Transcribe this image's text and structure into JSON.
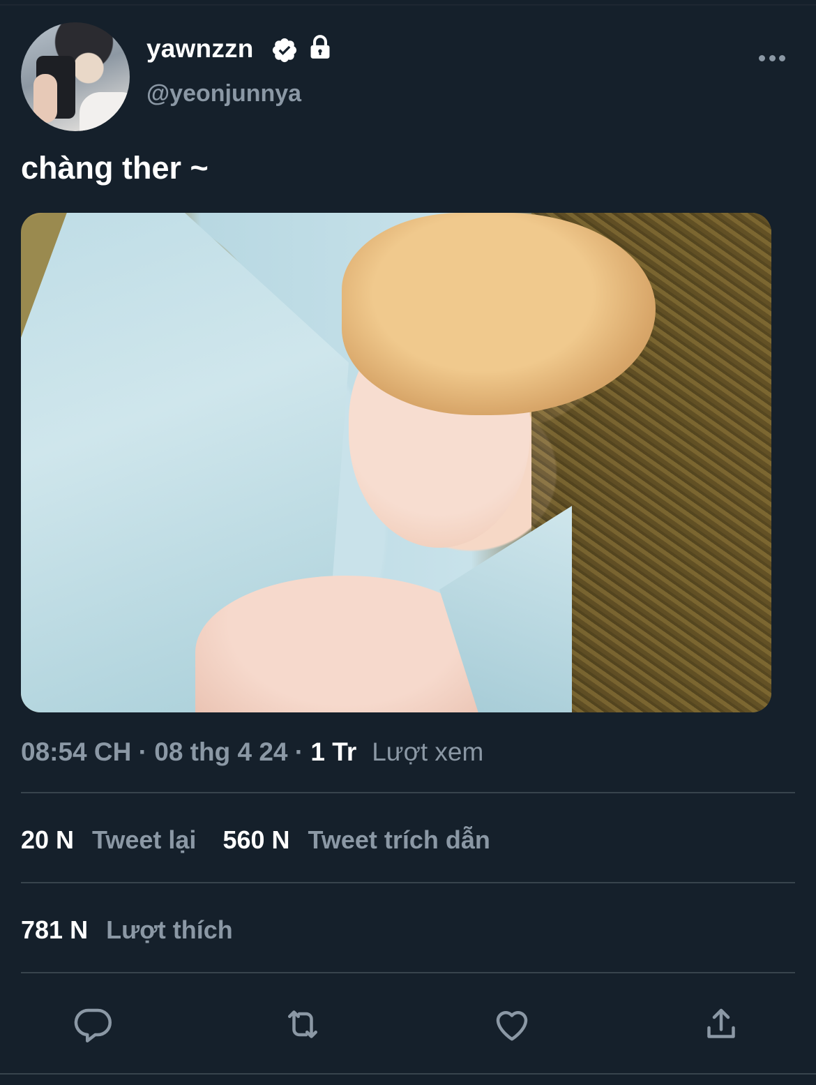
{
  "author": {
    "display_name": "yawnzzn",
    "handle": "@yeonjunnya",
    "verified_icon": "verified-badge-icon",
    "protected_icon": "lock-icon"
  },
  "tweet": {
    "text": "chàng ther ~"
  },
  "meta": {
    "time": "08:54 CH",
    "separator": " · ",
    "date": "08 thg 4 24",
    "separator2": " · ",
    "views_count": "1 Tr",
    "views_label": "Lượt xem"
  },
  "stats": {
    "retweets_count": "20 N",
    "retweets_label": "Tweet lại",
    "quotes_count": "560 N",
    "quotes_label": "Tweet trích dẫn",
    "likes_count": "781 N",
    "likes_label": "Lượt thích"
  },
  "actions": {
    "reply_icon": "reply-icon",
    "retweet_icon": "retweet-icon",
    "like_icon": "heart-icon",
    "share_icon": "share-icon"
  },
  "colors": {
    "background": "#15202b",
    "muted_text": "#8b98a5",
    "divider": "#38444d",
    "primary_text": "#ffffff"
  }
}
